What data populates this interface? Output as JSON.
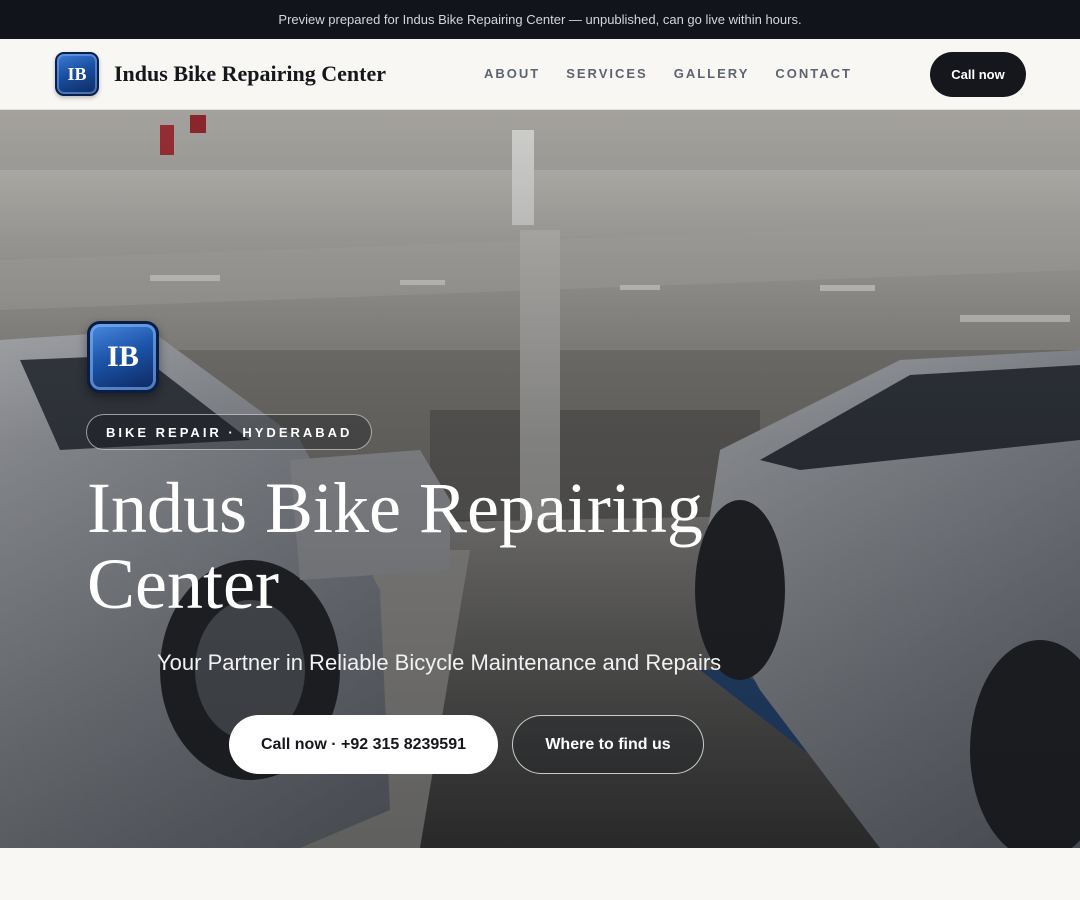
{
  "announcement": "Preview prepared for Indus Bike Repairing Center — unpublished, can go live within hours.",
  "brand": {
    "logo_text": "IB",
    "name": "Indus Bike Repairing Center"
  },
  "nav": {
    "items": [
      "ABOUT",
      "SERVICES",
      "GALLERY",
      "CONTACT"
    ],
    "cta_label": "Call now"
  },
  "hero": {
    "logo_text": "IB",
    "tag": "BIKE REPAIR · HYDERABAD",
    "title": "Indus Bike Repairing Center",
    "subtitle": "Your Partner in Reliable Bicycle Maintenance and Repairs",
    "primary_button": "Call now · +92 315 8239591",
    "secondary_button": "Where to find us"
  },
  "colors": {
    "topbar": "#11141a",
    "page_background": "#f8f7f4",
    "dark_button": "#15171c",
    "logo_blue": "#1a4fa0",
    "nav_link": "#5d6470"
  }
}
